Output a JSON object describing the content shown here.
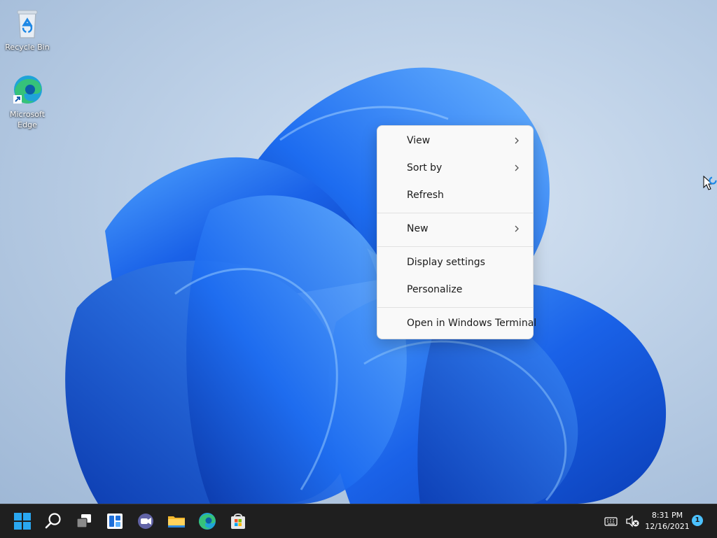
{
  "desktop": {
    "icons": [
      {
        "label": "Recycle Bin",
        "icon": "recycle-bin-icon"
      },
      {
        "label": "Microsoft Edge",
        "icon": "edge-icon"
      }
    ]
  },
  "context_menu": {
    "items": [
      {
        "label": "View",
        "submenu": true
      },
      {
        "label": "Sort by",
        "submenu": true
      },
      {
        "label": "Refresh",
        "submenu": false
      },
      {
        "label": "New",
        "submenu": true
      },
      {
        "label": "Display settings",
        "submenu": false
      },
      {
        "label": "Personalize",
        "submenu": false
      },
      {
        "label": "Open in Windows Terminal",
        "submenu": false
      }
    ]
  },
  "taskbar": {
    "apps": [
      "start-icon",
      "search-icon",
      "task-view-icon",
      "widgets-icon",
      "teams-chat-icon",
      "file-explorer-icon",
      "edge-icon",
      "microsoft-store-icon"
    ],
    "tray_icons": [
      "keyboard-icon",
      "speaker-muted-icon"
    ],
    "time": "8:31 PM",
    "date": "12/16/2021",
    "notification_count": "1"
  },
  "colors": {
    "accent": "#0078d4",
    "wallpaper_blue": "#1565e6",
    "taskbar_bg": "#1f1f1f",
    "menu_bg": "#f9f9f9"
  }
}
